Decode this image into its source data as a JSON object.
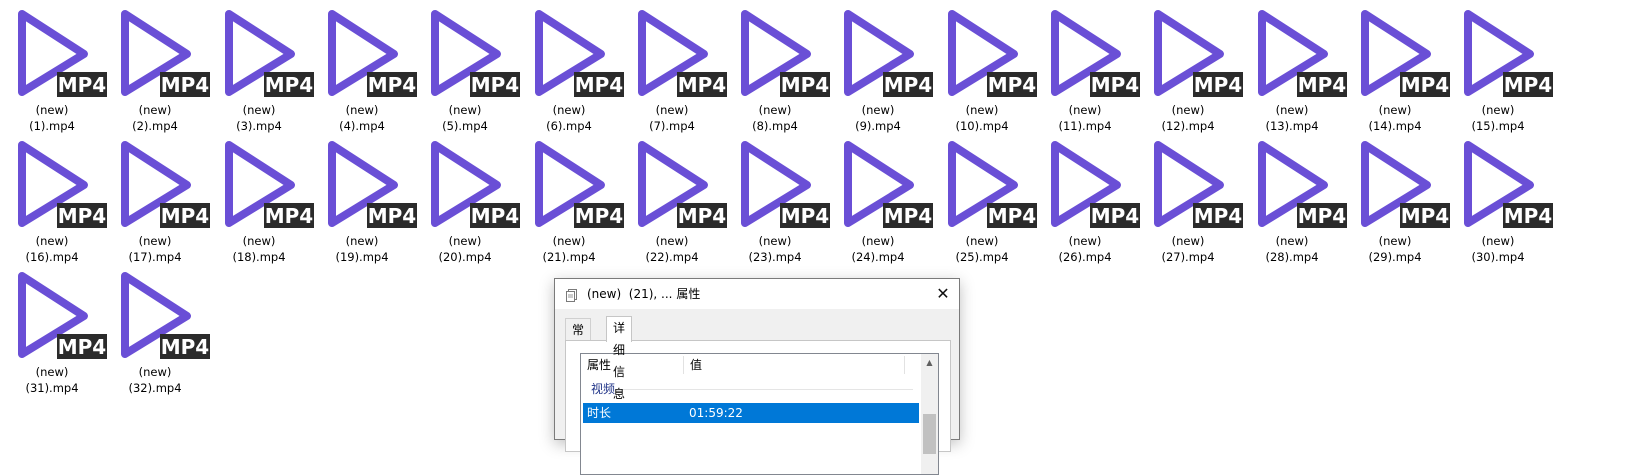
{
  "colors": {
    "icon_purple": "#6a4fd6",
    "badge_bg": "#2b2b2b",
    "badge_text": "#ffffff",
    "selection_blue": "#0078d7",
    "group_text": "#1e3287"
  },
  "files": [
    {
      "line1": "(new)",
      "line2": "(1).mp4",
      "badge": "MP4"
    },
    {
      "line1": "(new)",
      "line2": "(2).mp4",
      "badge": "MP4"
    },
    {
      "line1": "(new)",
      "line2": "(3).mp4",
      "badge": "MP4"
    },
    {
      "line1": "(new)",
      "line2": "(4).mp4",
      "badge": "MP4"
    },
    {
      "line1": "(new)",
      "line2": "(5).mp4",
      "badge": "MP4"
    },
    {
      "line1": "(new)",
      "line2": "(6).mp4",
      "badge": "MP4"
    },
    {
      "line1": "(new)",
      "line2": "(7).mp4",
      "badge": "MP4"
    },
    {
      "line1": "(new)",
      "line2": "(8).mp4",
      "badge": "MP4"
    },
    {
      "line1": "(new)",
      "line2": "(9).mp4",
      "badge": "MP4"
    },
    {
      "line1": "(new)",
      "line2": "(10).mp4",
      "badge": "MP4"
    },
    {
      "line1": "(new)",
      "line2": "(11).mp4",
      "badge": "MP4"
    },
    {
      "line1": "(new)",
      "line2": "(12).mp4",
      "badge": "MP4"
    },
    {
      "line1": "(new)",
      "line2": "(13).mp4",
      "badge": "MP4"
    },
    {
      "line1": "(new)",
      "line2": "(14).mp4",
      "badge": "MP4"
    },
    {
      "line1": "(new)",
      "line2": "(15).mp4",
      "badge": "MP4"
    },
    {
      "line1": "(new)",
      "line2": "(16).mp4",
      "badge": "MP4"
    },
    {
      "line1": "(new)",
      "line2": "(17).mp4",
      "badge": "MP4"
    },
    {
      "line1": "(new)",
      "line2": "(18).mp4",
      "badge": "MP4"
    },
    {
      "line1": "(new)",
      "line2": "(19).mp4",
      "badge": "MP4"
    },
    {
      "line1": "(new)",
      "line2": "(20).mp4",
      "badge": "MP4"
    },
    {
      "line1": "(new)",
      "line2": "(21).mp4",
      "badge": "MP4"
    },
    {
      "line1": "(new)",
      "line2": "(22).mp4",
      "badge": "MP4"
    },
    {
      "line1": "(new)",
      "line2": "(23).mp4",
      "badge": "MP4"
    },
    {
      "line1": "(new)",
      "line2": "(24).mp4",
      "badge": "MP4"
    },
    {
      "line1": "(new)",
      "line2": "(25).mp4",
      "badge": "MP4"
    },
    {
      "line1": "(new)",
      "line2": "(26).mp4",
      "badge": "MP4"
    },
    {
      "line1": "(new)",
      "line2": "(27).mp4",
      "badge": "MP4"
    },
    {
      "line1": "(new)",
      "line2": "(28).mp4",
      "badge": "MP4"
    },
    {
      "line1": "(new)",
      "line2": "(29).mp4",
      "badge": "MP4"
    },
    {
      "line1": "(new)",
      "line2": "(30).mp4",
      "badge": "MP4"
    },
    {
      "line1": "(new)",
      "line2": "(31).mp4",
      "badge": "MP4"
    },
    {
      "line1": "(new)",
      "line2": "(32).mp4",
      "badge": "MP4"
    }
  ],
  "dialog": {
    "title": "(new)  (21), ... 属性",
    "title_icon": "file-properties-icon",
    "close_glyph": "✕",
    "tabs": [
      {
        "label": "常规",
        "active": false
      },
      {
        "label": "详细信息",
        "active": true
      }
    ],
    "columns": {
      "property": "属性",
      "value": "值"
    },
    "group": "视频",
    "rows": [
      {
        "name": "时长",
        "value": "01:59:22",
        "selected": true
      }
    ],
    "scroll_up_glyph": "▲"
  }
}
